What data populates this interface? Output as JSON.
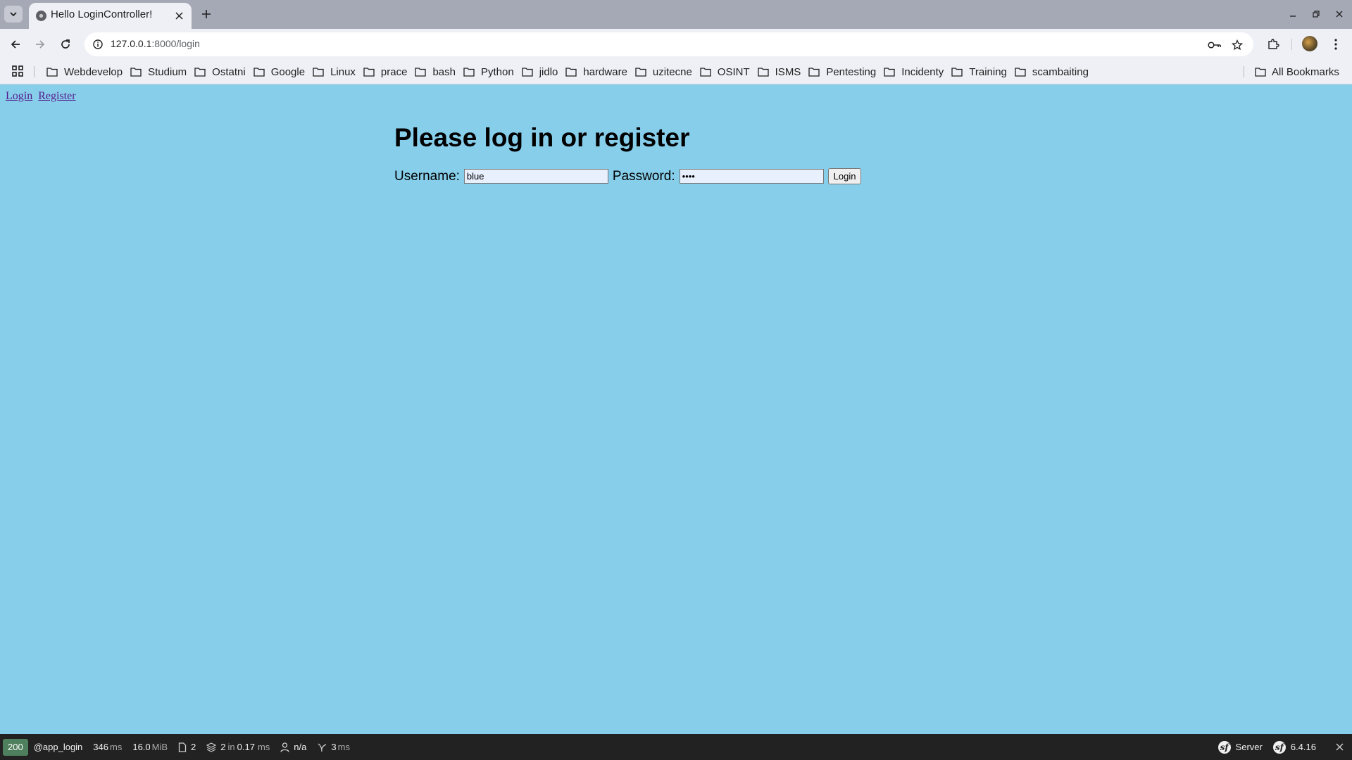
{
  "browser": {
    "tab_title": "Hello LoginController!",
    "url_host": "127.0.0.1",
    "url_path": ":8000/login",
    "bookmarks": [
      "Webdevelop",
      "Studium",
      "Ostatni",
      "Google",
      "Linux",
      "prace",
      "bash",
      "Python",
      "jidlo",
      "hardware",
      "uzitecne",
      "OSINT",
      "ISMS",
      "Pentesting",
      "Incidenty",
      "Training",
      "scambaiting"
    ],
    "all_bookmarks_label": "All Bookmarks"
  },
  "nav": {
    "login_link": "Login",
    "register_link": "Register"
  },
  "page": {
    "heading": "Please log in or register",
    "username_label": "Username:",
    "username_value": "blue",
    "password_label": "Password:",
    "password_value": "••••",
    "login_button": "Login"
  },
  "debug_toolbar": {
    "status_code": "200",
    "route": "@app_login",
    "time_value": "346",
    "time_unit": "ms",
    "memory_value": "16.0",
    "memory_unit": "MiB",
    "requests_count": "2",
    "cache_value": "2",
    "cache_in": "in",
    "cache_time": "0.17",
    "cache_unit": "ms",
    "user": "n/a",
    "twig_value": "3",
    "twig_unit": "ms",
    "server_label": "Server",
    "symfony_version": "6.4.16"
  },
  "colors": {
    "page_background": "#87ceeb",
    "status_ok": "#4f805d",
    "toolbar_background": "#222222"
  }
}
